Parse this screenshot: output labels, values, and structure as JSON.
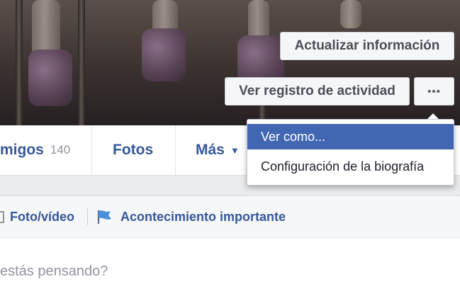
{
  "cover": {
    "update_info_label": "Actualizar información",
    "activity_log_label": "Ver registro de actividad",
    "more_label": "•••"
  },
  "nav": {
    "friends": {
      "label": "migos",
      "count": "140"
    },
    "photos_label": "Fotos",
    "more_label": "Más",
    "more_caret": "▼"
  },
  "composer": {
    "photo_video_label": "Foto/vídeo",
    "life_event_label": "Acontecimiento importante",
    "placeholder": "estás pensando?"
  },
  "dropdown": {
    "items": [
      {
        "label": "Ver como...",
        "selected": true
      },
      {
        "label": "Configuración de la biografía",
        "selected": false
      }
    ]
  },
  "colors": {
    "link": "#365899",
    "highlight": "#4267b2",
    "page_bg": "#e9ebee"
  }
}
